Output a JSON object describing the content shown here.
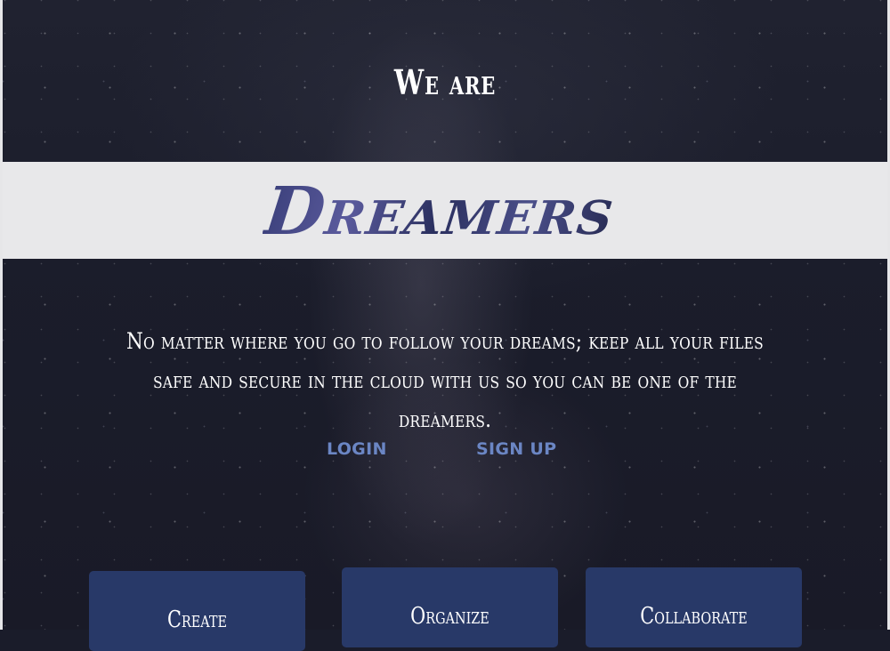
{
  "hero": {
    "heading": "We are",
    "brand": "Dreamers",
    "tagline": "No matter where you go to follow your dreams; keep all your files safe and secure in the cloud with us so you can be one of the dreamers."
  },
  "nav": {
    "login_label": "LOGIN",
    "signup_label": "SIGN UP"
  },
  "features": [
    {
      "label": "Create"
    },
    {
      "label": "Organize"
    },
    {
      "label": "Collaborate"
    }
  ],
  "colors": {
    "background": "#1b1d2b",
    "band": "#e8e8ea",
    "brand_text": "#2e3566",
    "link": "#6b86c4",
    "card": "#283968"
  }
}
